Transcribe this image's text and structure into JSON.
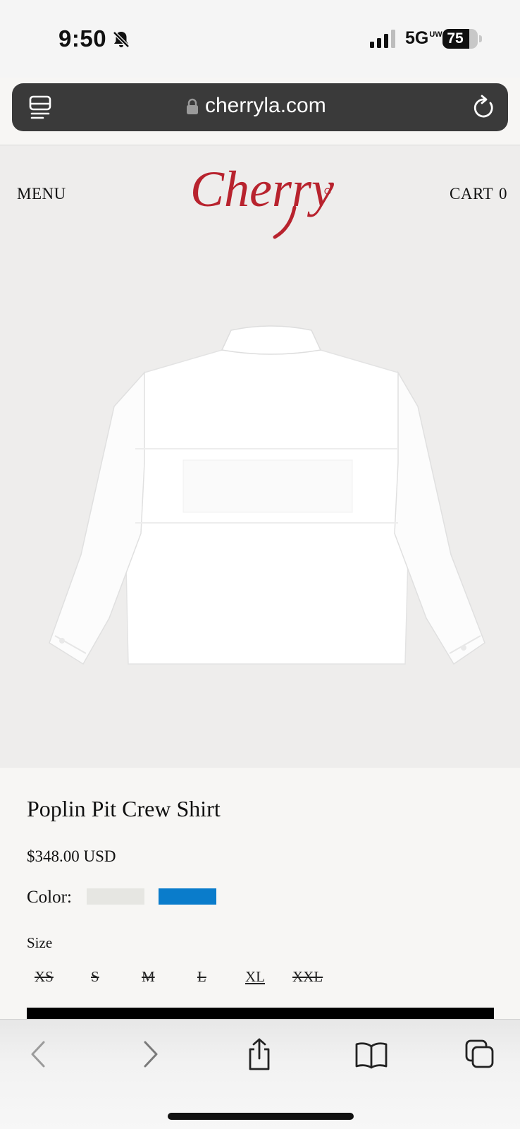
{
  "status_bar": {
    "time": "9:50",
    "network": "5G",
    "network_badge": "UW",
    "battery": "75",
    "battery_level": 0.75,
    "icons": [
      "bell-off-icon",
      "cellular-signal-icon",
      "battery-icon"
    ]
  },
  "address_bar": {
    "url": "cherryla.com",
    "icons": [
      "reader-mode-icon",
      "lock-icon",
      "reload-icon"
    ]
  },
  "header": {
    "menu_label": "MENU",
    "logo_text": "Cherry",
    "cart_label": "CART",
    "cart_count": "0"
  },
  "product": {
    "title": "Poplin Pit Crew Shirt",
    "price": "$348.00 USD",
    "color_label": "Color:",
    "color_swatches": [
      "#e6e6e2",
      "#0a7ccb"
    ],
    "size_label": "Size",
    "sizes": [
      {
        "label": "XS",
        "available": false
      },
      {
        "label": "S",
        "available": false
      },
      {
        "label": "M",
        "available": false
      },
      {
        "label": "L",
        "available": false
      },
      {
        "label": "XL",
        "available": true
      },
      {
        "label": "XXL",
        "available": false
      }
    ]
  },
  "toolbar": {
    "icons": [
      "back-icon",
      "forward-icon",
      "share-icon",
      "bookmarks-icon",
      "tabs-icon"
    ]
  },
  "colors": {
    "brand_red": "#b8232e",
    "page_bg": "#f7f6f4",
    "hero_bg": "#eeedec"
  }
}
